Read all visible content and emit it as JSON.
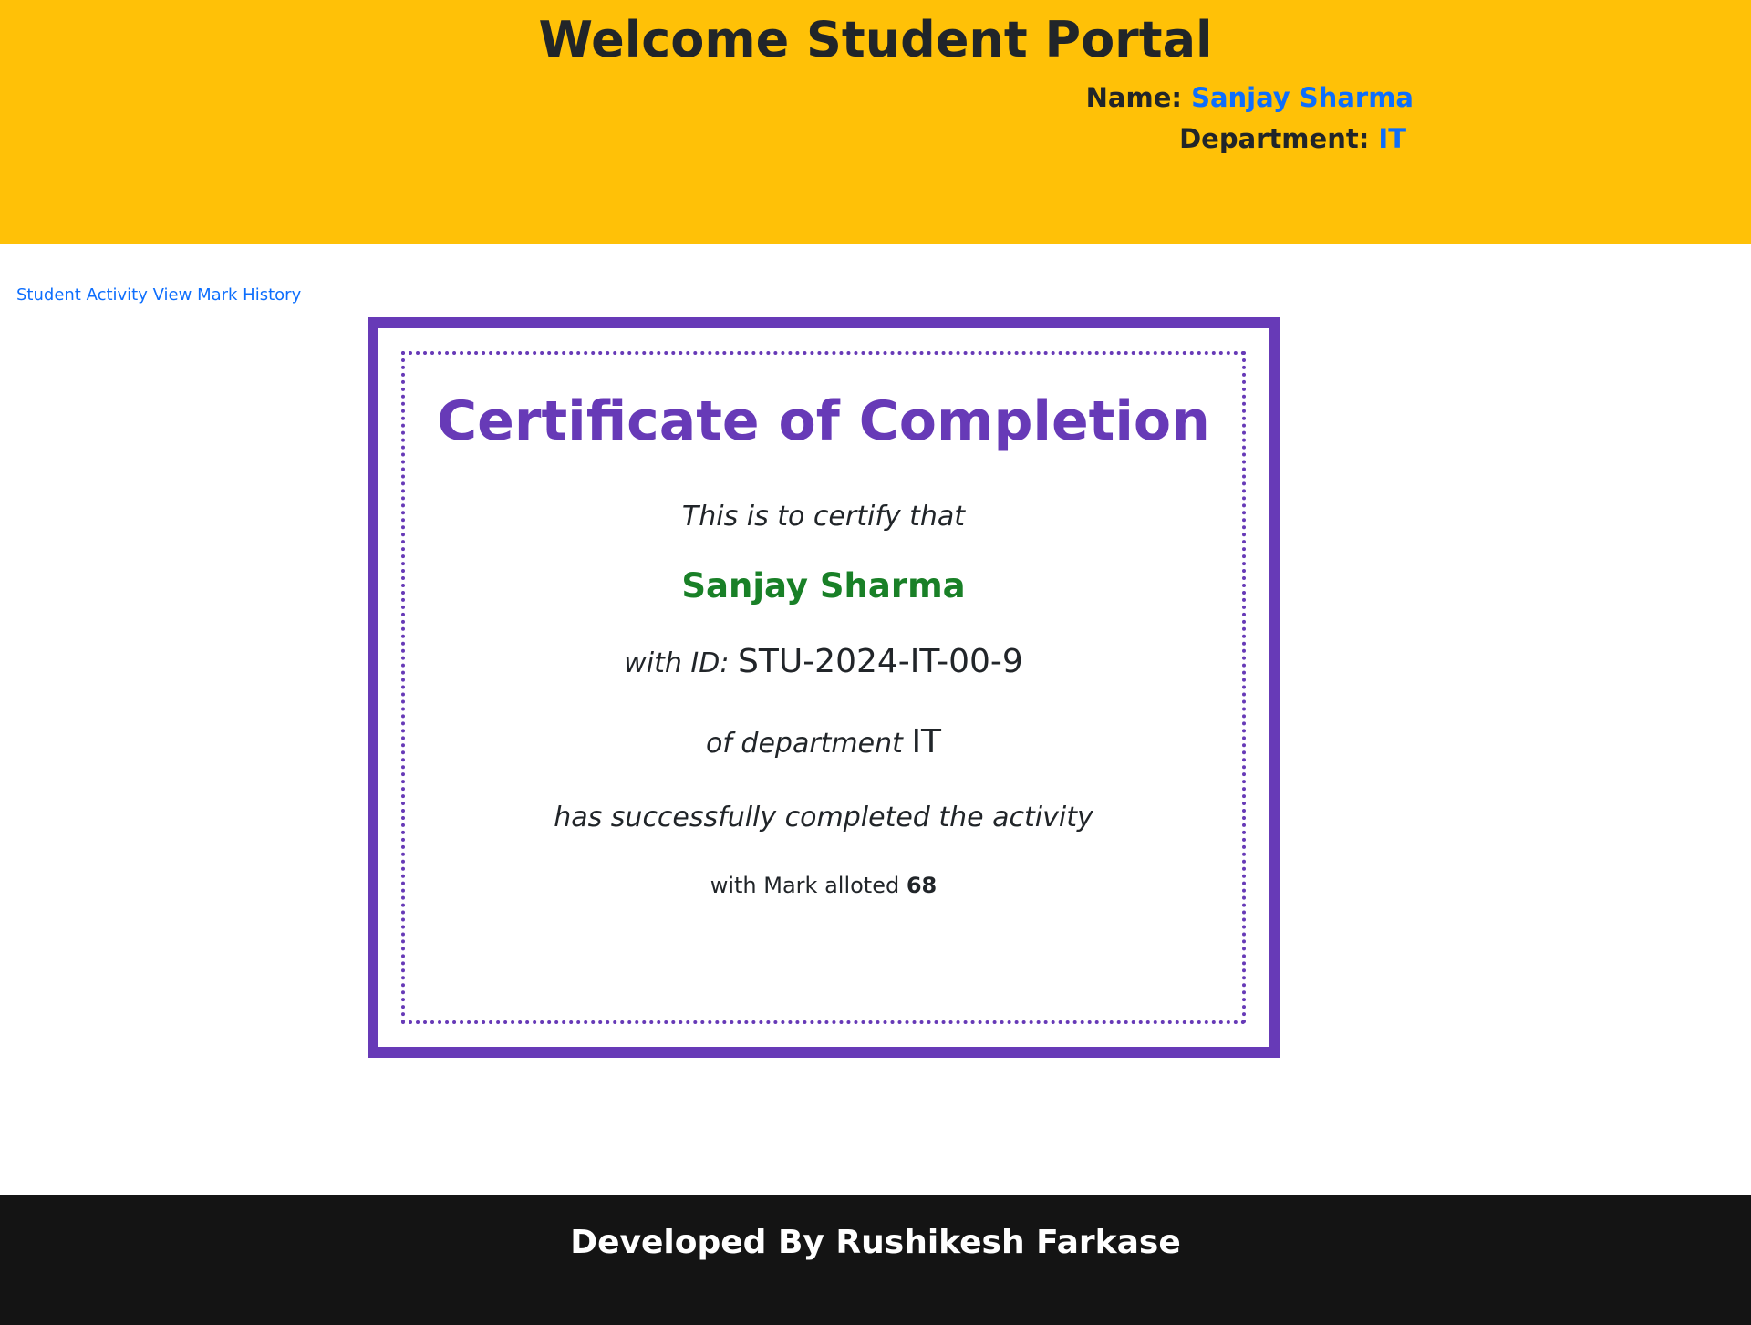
{
  "header": {
    "title": "Welcome Student Portal",
    "name_label": "Name:",
    "name_value": "Sanjay Sharma",
    "department_label": "Department:",
    "department_value": "IT"
  },
  "nav": {
    "student_activity": "Student Activity",
    "view_mark_history": "View Mark History"
  },
  "certificate": {
    "title": "Certificate of Completion",
    "certify_text": "This is to certify that",
    "student_name": "Sanjay Sharma",
    "id_prefix": "with ID:",
    "student_id": "STU-2024-IT-00-9",
    "department_prefix": "of department",
    "department": "IT",
    "completed_text": "has successfully completed the activity",
    "mark_prefix": "with Mark alloted",
    "mark": "68"
  },
  "footer": {
    "text": "Developed By Rushikesh Farkase"
  },
  "colors": {
    "header_bg": "#ffc107",
    "accent_blue": "#0d6efd",
    "certificate_purple": "#673ab7",
    "name_green": "#198027",
    "footer_bg": "#141414"
  }
}
